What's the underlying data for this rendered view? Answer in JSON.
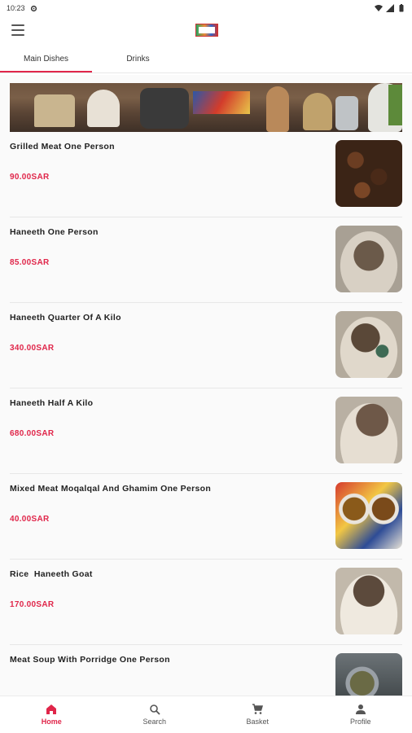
{
  "status_bar": {
    "time": "10:23"
  },
  "tabs": [
    {
      "label": "Main Dishes",
      "active": true
    },
    {
      "label": "Drinks",
      "active": false
    }
  ],
  "items": [
    {
      "name": "Grilled Meat One Person",
      "price": "90.00SAR"
    },
    {
      "name": "Haneeth One Person",
      "price": "85.00SAR"
    },
    {
      "name": "Haneeth Quarter Of A Kilo",
      "price": "340.00SAR"
    },
    {
      "name": "Haneeth Half A Kilo",
      "price": "680.00SAR"
    },
    {
      "name": "Mixed Meat Moqalqal And Ghamim One Person",
      "price": "40.00SAR"
    },
    {
      "name": "Rice  Haneeth Goat",
      "price": "170.00SAR"
    },
    {
      "name": "Meat Soup With Porridge One Person",
      "price": ""
    }
  ],
  "bottom_nav": [
    {
      "label": "Home",
      "icon": "home-icon",
      "active": true
    },
    {
      "label": "Search",
      "icon": "search-icon",
      "active": false
    },
    {
      "label": "Basket",
      "icon": "cart-icon",
      "active": false
    },
    {
      "label": "Profile",
      "icon": "person-icon",
      "active": false
    }
  ],
  "colors": {
    "accent": "#e0264a",
    "text": "#222222",
    "background": "#fafafa"
  }
}
